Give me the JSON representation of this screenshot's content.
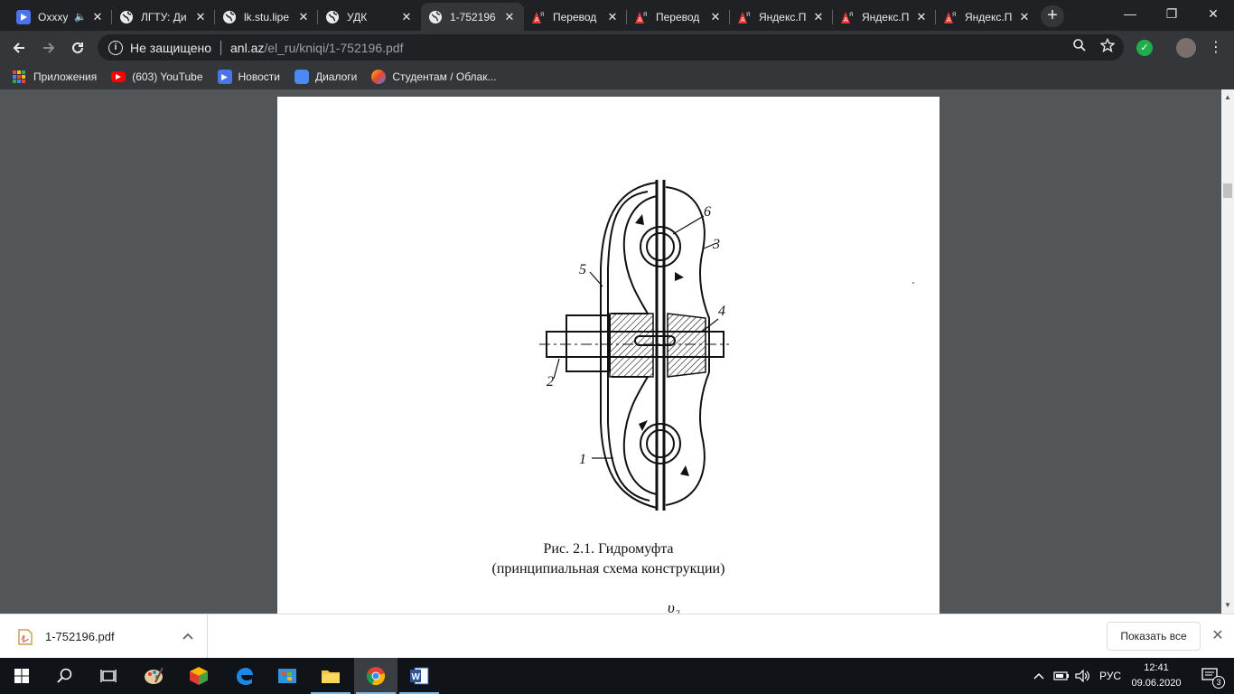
{
  "tabs": [
    {
      "title": "Oxxxy",
      "icon": "play-icon",
      "audio": true
    },
    {
      "title": "ЛГТУ: Ди",
      "icon": "globe-icon"
    },
    {
      "title": "lk.stu.lipe",
      "icon": "globe-icon"
    },
    {
      "title": "УДК",
      "icon": "globe-icon"
    },
    {
      "title": "1-752196",
      "icon": "globe-icon",
      "active": true
    },
    {
      "title": "Перевод",
      "icon": "yandex-translate-icon"
    },
    {
      "title": "Перевод",
      "icon": "yandex-translate-icon"
    },
    {
      "title": "Яндекс.П",
      "icon": "yandex-translate-icon"
    },
    {
      "title": "Яндекс.П",
      "icon": "yandex-translate-icon"
    },
    {
      "title": "Яндекс.П",
      "icon": "yandex-translate-icon"
    }
  ],
  "omnibox": {
    "security_label": "Не защищено",
    "url_host": "anl.az",
    "url_path": "/el_ru/kniqi/1-752196.pdf"
  },
  "bookmarks": [
    {
      "label": "Приложения",
      "icon": "apps-icon"
    },
    {
      "label": "(603) YouTube",
      "icon": "youtube-icon"
    },
    {
      "label": "Новости",
      "icon": "play-icon"
    },
    {
      "label": "Диалоги",
      "icon": "chat-icon"
    },
    {
      "label": "Студентам / Облак...",
      "icon": "cloud-icon"
    }
  ],
  "figure": {
    "labels": [
      "6",
      "3",
      "5",
      "4",
      "2",
      "1"
    ],
    "caption_line1": "Рис. 2.1. Гидромуфта",
    "caption_line2": "(принципиальная схема конструкции)",
    "formula_fragment": "υ₂"
  },
  "downloads": {
    "file_name": "1-752196.pdf",
    "show_all": "Показать все"
  },
  "tray": {
    "language": "РУС",
    "time": "12:41",
    "date": "09.06.2020",
    "notifications": "3"
  },
  "colors": {
    "chrome_dark": "#202124",
    "chrome_toolbar": "#35363a",
    "pdf_bg": "#525659",
    "taskbar": "#101317"
  }
}
